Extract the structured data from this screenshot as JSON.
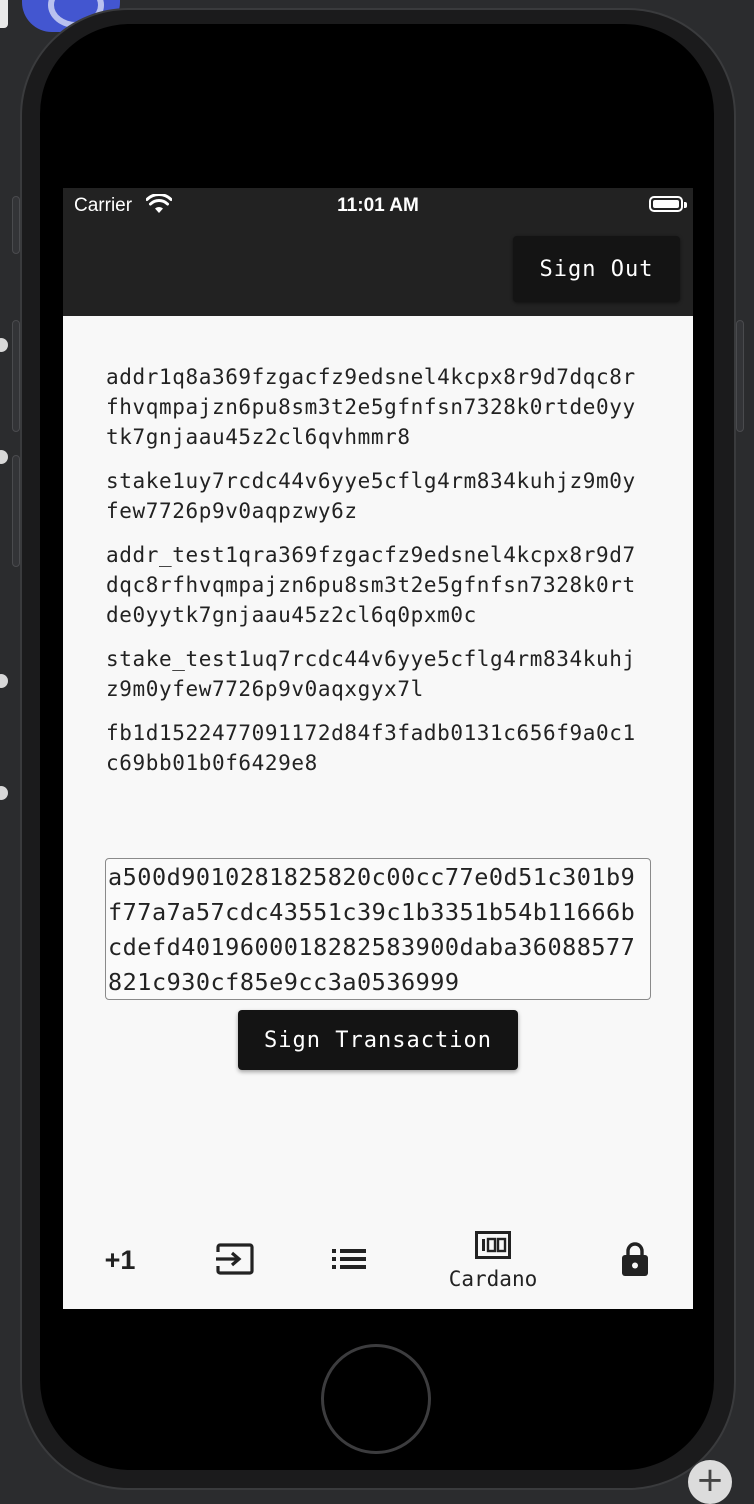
{
  "status_bar": {
    "carrier": "Carrier",
    "time": "11:01 AM"
  },
  "app_bar": {
    "sign_out_label": "Sign Out"
  },
  "addresses": {
    "address_mainnet": "addr1q8a369fzgacfz9edsnel4kcpx8r9d7dqc8rfhvqmpajzn6pu8sm3t2e5gfnfsn7328k0rtde0yytk7gnjaau45z2cl6qvhmmr8",
    "stake_mainnet": "stake1uy7rcdc44v6yye5cflg4rm834kuhjz9m0yfew7726p9v0aqpzwy6z",
    "address_testnet": "addr_test1qra369fzgacfz9edsnel4kcpx8r9d7dqc8rfhvqmpajzn6pu8sm3t2e5gfnfsn7328k0rtde0yytk7gnjaau45z2cl6q0pxm0c",
    "stake_testnet": "stake_test1uq7rcdc44v6yye5cflg4rm834kuhjz9m0yfew7726p9v0aqxgyx7l",
    "key_hash": "fb1d1522477091172d84f3fadb0131c656f9a0c1c69bb01b0f6429e8"
  },
  "transaction": {
    "input_value": "a500d9010281825820c00cc77e0d51c301b9f77a7a57cdc43551c39c1b3351b54b11666bcdefd4019600018282583900daba36088577821c930cf85e9cc3a0536999",
    "sign_label": "Sign Transaction"
  },
  "bottom_nav": {
    "items": [
      {
        "icon": "plus-one-icon",
        "label": "+1"
      },
      {
        "icon": "input-icon",
        "label": ""
      },
      {
        "icon": "list-icon",
        "label": ""
      },
      {
        "icon": "counter-icon",
        "label": "Cardano"
      },
      {
        "icon": "lock-icon",
        "label": ""
      }
    ]
  },
  "colors": {
    "app_bar": "#222222",
    "button": "#141414",
    "background": "#f8f8f8",
    "simulator_accent": "#4356d0"
  }
}
